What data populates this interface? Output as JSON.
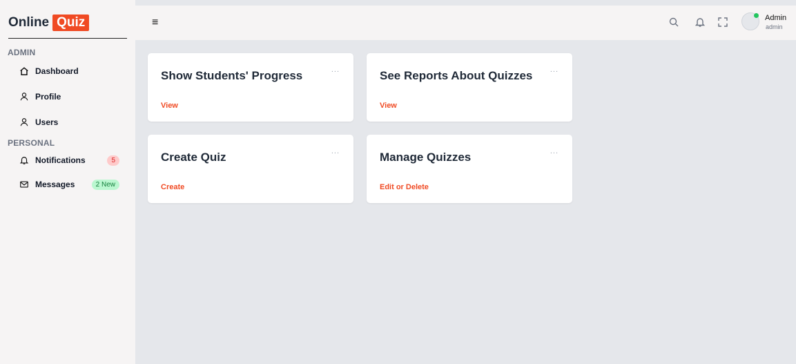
{
  "brand": {
    "part1": "Online",
    "part2": "Quiz"
  },
  "sidebar": {
    "admin_title": "ADMIN",
    "personal_title": "PERSONAL",
    "items": [
      {
        "label": "Dashboard",
        "icon": "home-icon"
      },
      {
        "label": "Profile",
        "icon": "user-icon"
      },
      {
        "label": "Users",
        "icon": "user-icon"
      },
      {
        "label": "Notifications",
        "icon": "bell-icon",
        "badge": "5"
      },
      {
        "label": "Messages",
        "icon": "mail-icon",
        "badge": "2 New"
      }
    ]
  },
  "header": {
    "menu_icon": "≡",
    "user": {
      "name": "Admin",
      "role": "admin"
    },
    "icons": [
      "search-icon",
      "bell-icon",
      "fullscreen-icon"
    ]
  },
  "cards": [
    {
      "title": "Show Students' Progress",
      "link": "View",
      "menu": "..."
    },
    {
      "title": "See Reports About Quizzes",
      "link": "View",
      "menu": "..."
    },
    {
      "title": "Create Quiz",
      "link": "Create",
      "menu": "..."
    },
    {
      "title": "Manage Quizzes",
      "link": "Edit or Delete",
      "menu": "..."
    }
  ],
  "colors": {
    "accent": "#f04a23",
    "sidebar_bg": "#f6f4f4",
    "content_bg": "#e5e7eb",
    "online": "#22c55e"
  }
}
